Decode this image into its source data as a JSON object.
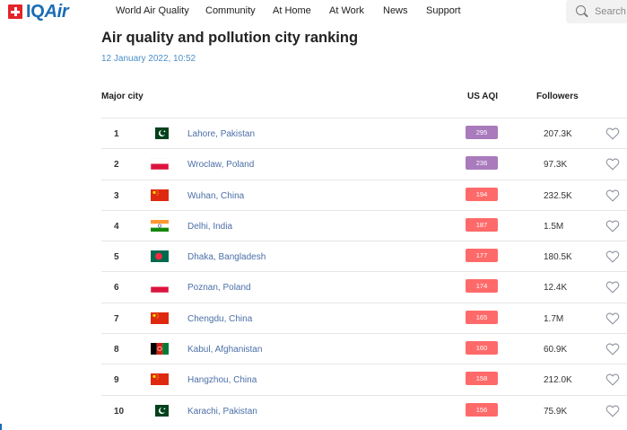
{
  "brand": {
    "logo_prefix": "IQ",
    "logo_suffix": "Air"
  },
  "nav": {
    "items": [
      "World Air Quality",
      "Community",
      "At Home",
      "At Work",
      "News",
      "Support"
    ]
  },
  "search": {
    "placeholder": "Search"
  },
  "page": {
    "title": "Air quality and pollution city ranking",
    "timestamp": "12 January 2022, 10:52"
  },
  "table": {
    "headers": {
      "city": "Major city",
      "aqi": "US AQI",
      "followers": "Followers"
    },
    "rows": [
      {
        "rank": "1",
        "flag": "pakistan",
        "city": "Lahore, Pakistan",
        "aqi": "295",
        "aqi_color": "#a97abc",
        "followers": "207.3K"
      },
      {
        "rank": "2",
        "flag": "poland",
        "city": "Wroclaw, Poland",
        "aqi": "236",
        "aqi_color": "#a97abc",
        "followers": "97.3K"
      },
      {
        "rank": "3",
        "flag": "china",
        "city": "Wuhan, China",
        "aqi": "194",
        "aqi_color": "#fe6a69",
        "followers": "232.5K"
      },
      {
        "rank": "4",
        "flag": "india",
        "city": "Delhi, India",
        "aqi": "187",
        "aqi_color": "#fe6a69",
        "followers": "1.5M"
      },
      {
        "rank": "5",
        "flag": "bangladesh",
        "city": "Dhaka, Bangladesh",
        "aqi": "177",
        "aqi_color": "#fe6a69",
        "followers": "180.5K"
      },
      {
        "rank": "6",
        "flag": "poland",
        "city": "Poznan, Poland",
        "aqi": "174",
        "aqi_color": "#fe6a69",
        "followers": "12.4K"
      },
      {
        "rank": "7",
        "flag": "china",
        "city": "Chengdu, China",
        "aqi": "165",
        "aqi_color": "#fe6a69",
        "followers": "1.7M"
      },
      {
        "rank": "8",
        "flag": "afghanistan",
        "city": "Kabul, Afghanistan",
        "aqi": "160",
        "aqi_color": "#fe6a69",
        "followers": "60.9K"
      },
      {
        "rank": "9",
        "flag": "china",
        "city": "Hangzhou, China",
        "aqi": "158",
        "aqi_color": "#fe6a69",
        "followers": "212.0K"
      },
      {
        "rank": "10",
        "flag": "pakistan",
        "city": "Karachi, Pakistan",
        "aqi": "156",
        "aqi_color": "#fe6a69",
        "followers": "75.9K"
      }
    ]
  }
}
